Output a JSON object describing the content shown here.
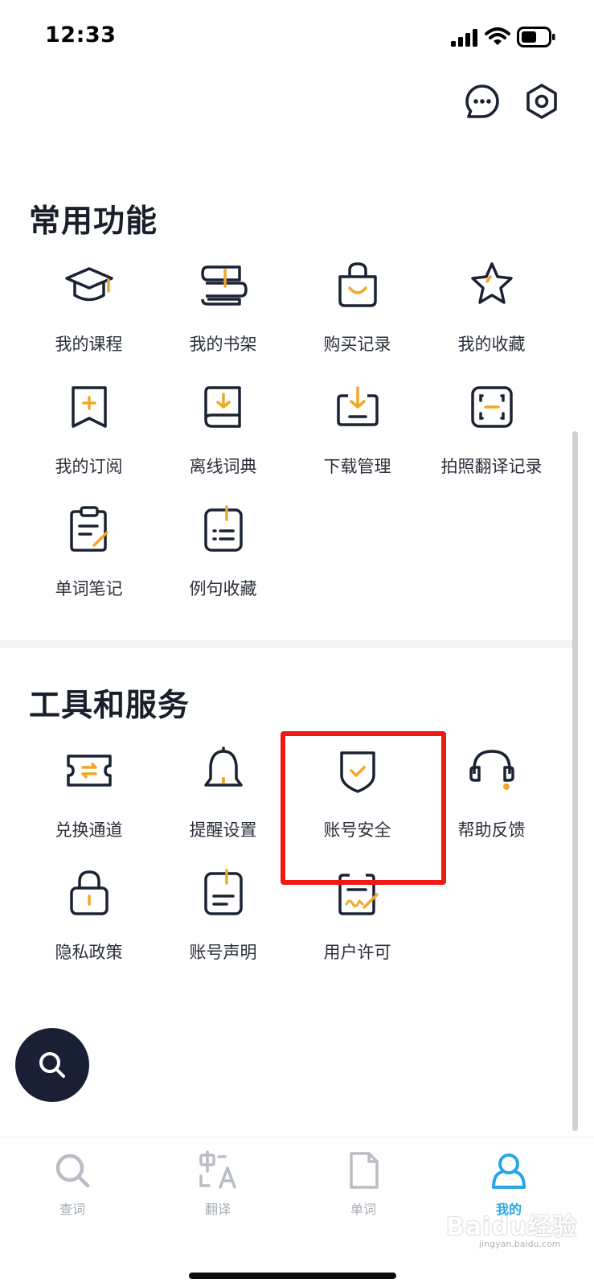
{
  "status_bar": {
    "time": "12:33"
  },
  "colors": {
    "icon_dark": "#1b2333",
    "icon_accent": "#f2a72a",
    "tab_active": "#2aa6e6",
    "tab_inactive": "#a6abb3",
    "fab_bg": "#192036",
    "highlight": "#ef1a14"
  },
  "top_actions": [
    {
      "icon": "chat-bubble-icon"
    },
    {
      "icon": "settings-hexagon-icon"
    }
  ],
  "common": {
    "title": "常用功能",
    "items": [
      {
        "label": "我的课程",
        "icon": "graduation-cap-icon"
      },
      {
        "label": "我的书架",
        "icon": "bookshelf-icon"
      },
      {
        "label": "购买记录",
        "icon": "shopping-bag-icon"
      },
      {
        "label": "我的收藏",
        "icon": "star-icon"
      },
      {
        "label": "我的订阅",
        "icon": "subscription-bookmark-icon"
      },
      {
        "label": "离线词典",
        "icon": "offline-dictionary-icon"
      },
      {
        "label": "下载管理",
        "icon": "download-tray-icon"
      },
      {
        "label": "拍照翻译记录",
        "icon": "scan-frame-icon"
      },
      {
        "label": "单词笔记",
        "icon": "note-clipboard-icon"
      },
      {
        "label": "例句收藏",
        "icon": "sentence-list-icon"
      }
    ]
  },
  "tools": {
    "title": "工具和服务",
    "items": [
      {
        "label": "兑换通道",
        "icon": "ticket-exchange-icon"
      },
      {
        "label": "提醒设置",
        "icon": "bell-icon"
      },
      {
        "label": "账号安全",
        "icon": "shield-check-icon"
      },
      {
        "label": "帮助反馈",
        "icon": "headset-icon"
      },
      {
        "label": "隐私政策",
        "icon": "lock-icon"
      },
      {
        "label": "账号声明",
        "icon": "document-icon"
      },
      {
        "label": "用户许可",
        "icon": "signed-document-icon"
      }
    ]
  },
  "fab": {
    "icon": "search-icon"
  },
  "tabs": [
    {
      "label": "查词",
      "icon": "search-icon",
      "active": false
    },
    {
      "label": "翻译",
      "icon": "translate-icon",
      "active": false
    },
    {
      "label": "单词",
      "icon": "word-file-icon",
      "active": false
    },
    {
      "label": "我的",
      "icon": "user-icon",
      "active": true
    }
  ],
  "watermark": {
    "text": "Baidu经验",
    "sub": "jingyan.baidu.com"
  }
}
